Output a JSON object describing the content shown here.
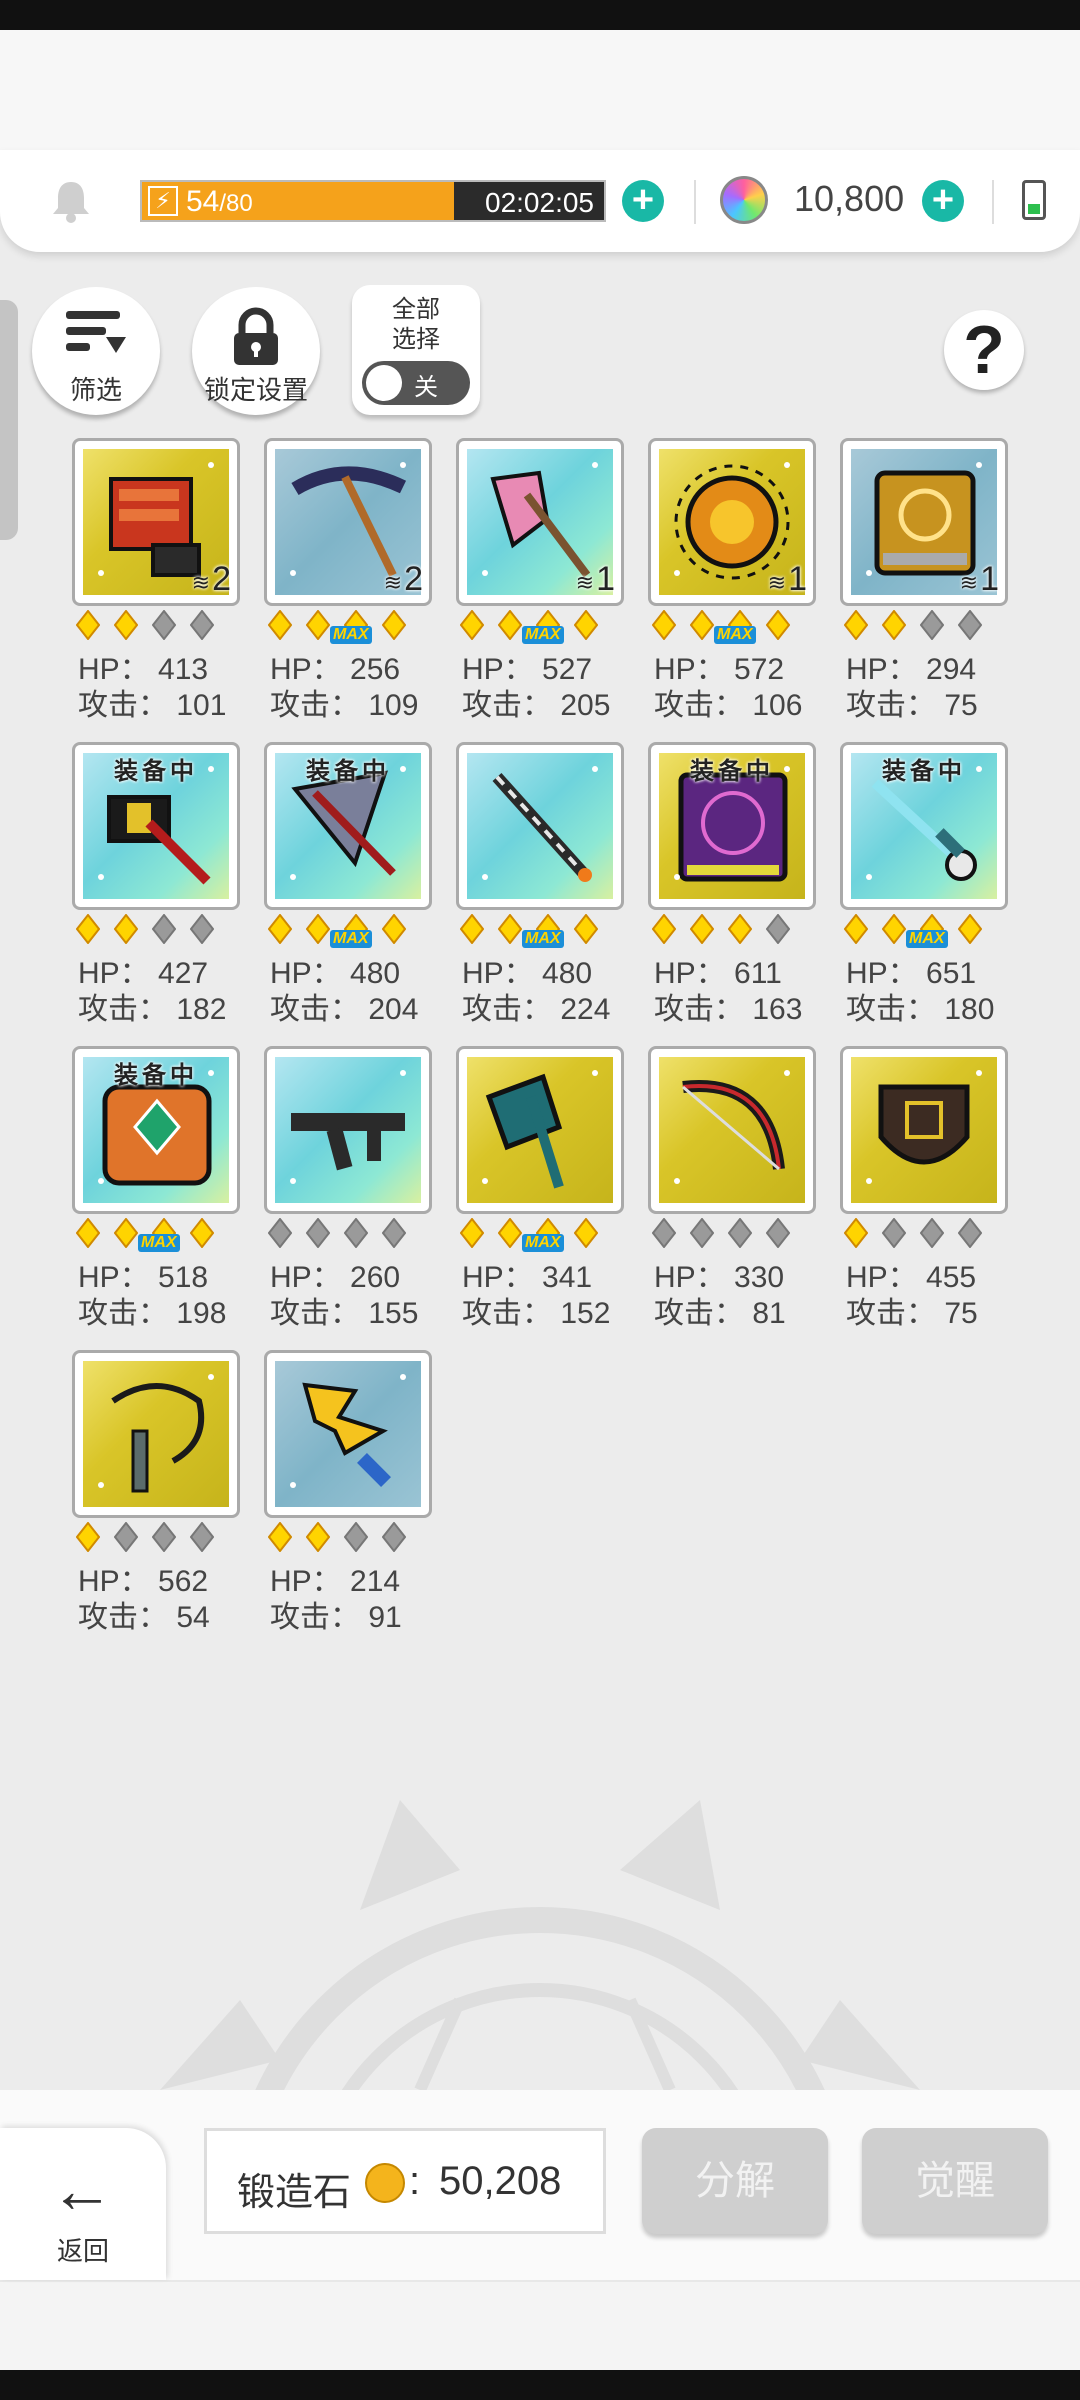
{
  "header": {
    "energy_current": "54",
    "energy_max": "/80",
    "energy_fraction": 0.675,
    "timer": "02:02:05",
    "gem_count": "10,800"
  },
  "controls": {
    "filter_label": "筛选",
    "lock_label": "锁定设置",
    "select_all_line1": "全部",
    "select_all_line2": "选择",
    "toggle_label": "关",
    "help_label": "?"
  },
  "equip_tag": "装备中",
  "max_tag": "MAX",
  "hp_prefix": "HP： ",
  "atk_prefix": "攻击： ",
  "items": [
    {
      "name": "red-gauntlet",
      "bg": "gold",
      "stars": 2,
      "max": false,
      "equipped": false,
      "stack": "2",
      "hp": "413",
      "atk": "101"
    },
    {
      "name": "dark-pickaxe",
      "bg": "blue",
      "stars": 4,
      "max": true,
      "equipped": false,
      "stack": "2",
      "hp": "256",
      "atk": "109"
    },
    {
      "name": "pink-axe",
      "bg": "teal",
      "stars": 4,
      "max": true,
      "equipped": false,
      "stack": "1",
      "hp": "527",
      "atk": "205"
    },
    {
      "name": "sun-orb",
      "bg": "gold",
      "stars": 4,
      "max": true,
      "equipped": false,
      "stack": "1",
      "hp": "572",
      "atk": "106"
    },
    {
      "name": "gold-tome",
      "bg": "blue",
      "stars": 2,
      "max": false,
      "equipped": false,
      "stack": "1",
      "hp": "294",
      "atk": "75"
    },
    {
      "name": "black-hammer",
      "bg": "teal",
      "stars": 2,
      "max": false,
      "equipped": true,
      "stack": "",
      "hp": "427",
      "atk": "182"
    },
    {
      "name": "silver-crossbow",
      "bg": "teal",
      "stars": 4,
      "max": true,
      "equipped": true,
      "stack": "",
      "hp": "480",
      "atk": "204"
    },
    {
      "name": "lance-staff",
      "bg": "teal",
      "stars": 4,
      "max": true,
      "equipped": false,
      "stack": "",
      "hp": "480",
      "atk": "224"
    },
    {
      "name": "purple-grimoire",
      "bg": "gold",
      "stars": 3,
      "max": false,
      "equipped": true,
      "stack": "",
      "hp": "611",
      "atk": "163"
    },
    {
      "name": "crystal-rapier",
      "bg": "teal",
      "stars": 4,
      "max": true,
      "equipped": true,
      "stack": "",
      "hp": "651",
      "atk": "180"
    },
    {
      "name": "ruby-spellbook",
      "bg": "teal",
      "stars": 4,
      "max": true,
      "equipped": true,
      "stack": "",
      "hp": "518",
      "atk": "198"
    },
    {
      "name": "assault-rifle",
      "bg": "teal",
      "stars": 0,
      "max": false,
      "equipped": false,
      "stack": "",
      "hp": "260",
      "atk": "155"
    },
    {
      "name": "teal-battleaxe",
      "bg": "gold",
      "stars": 4,
      "max": true,
      "equipped": false,
      "stack": "",
      "hp": "341",
      "atk": "152"
    },
    {
      "name": "red-longbow",
      "bg": "gold",
      "stars": 0,
      "max": false,
      "equipped": false,
      "stack": "",
      "hp": "330",
      "atk": "81"
    },
    {
      "name": "horned-shield",
      "bg": "gold",
      "stars": 1,
      "max": false,
      "equipped": false,
      "stack": "",
      "hp": "455",
      "atk": "75"
    },
    {
      "name": "chain-whip",
      "bg": "gold",
      "stars": 1,
      "max": false,
      "equipped": false,
      "stack": "",
      "hp": "562",
      "atk": "54"
    },
    {
      "name": "lightning-sword",
      "bg": "blue",
      "stars": 2,
      "max": false,
      "equipped": false,
      "stack": "",
      "hp": "214",
      "atk": "91"
    }
  ],
  "bottom": {
    "back_label": "返回",
    "forge_label": "锻造石",
    "forge_colon": ":",
    "forge_value": "50,208",
    "disassemble_label": "分解",
    "awaken_label": "觉醒"
  },
  "colors": {
    "energy_fill": "#f5a21b",
    "plus": "#19b8a6",
    "star_gold": "#ffd400",
    "star_gray": "#9a9a9a"
  }
}
